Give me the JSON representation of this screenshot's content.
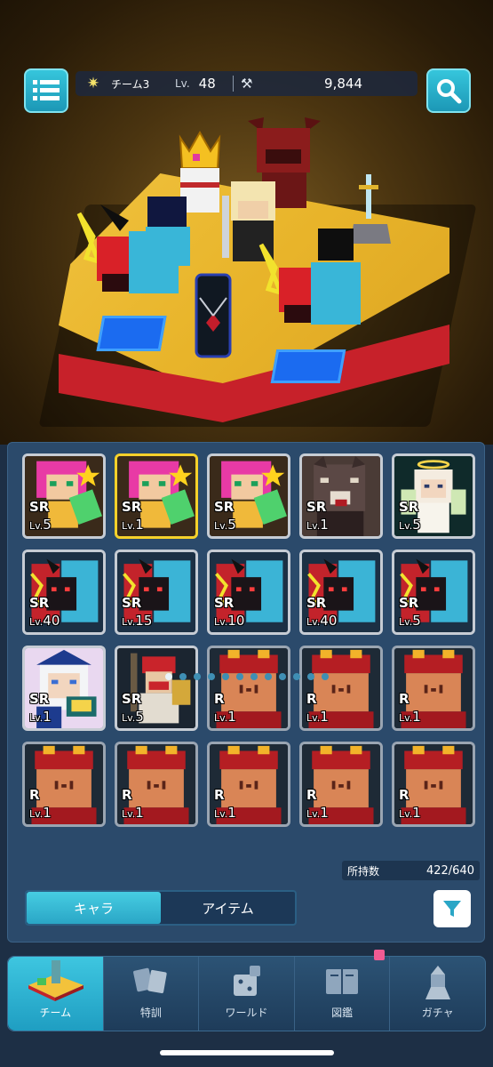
{
  "header": {
    "team_name": "チーム3",
    "level_label": "Lv.",
    "level_value": "48",
    "power_value": "9,844",
    "icons": [
      "list-menu-icon",
      "team-star-icon",
      "power-icon",
      "search-icon"
    ]
  },
  "inventory": {
    "cards": [
      {
        "rank": "SR",
        "level": "5",
        "art": "pink-hair-girl",
        "selected": false
      },
      {
        "rank": "SR",
        "level": "1",
        "art": "pink-hair-girl",
        "selected": true
      },
      {
        "rank": "SR",
        "level": "5",
        "art": "pink-hair-girl",
        "selected": false
      },
      {
        "rank": "SR",
        "level": "1",
        "art": "wolf",
        "selected": false
      },
      {
        "rank": "SR",
        "level": "5",
        "art": "angel",
        "selected": false
      },
      {
        "rank": "SR",
        "level": "40",
        "art": "red-blue-beast",
        "selected": false
      },
      {
        "rank": "SR",
        "level": "15",
        "art": "red-blue-beast",
        "selected": false
      },
      {
        "rank": "SR",
        "level": "10",
        "art": "red-blue-beast",
        "selected": false
      },
      {
        "rank": "SR",
        "level": "40",
        "art": "red-blue-beast",
        "selected": false
      },
      {
        "rank": "SR",
        "level": "5",
        "art": "red-blue-beast",
        "selected": false
      },
      {
        "rank": "SR",
        "level": "1",
        "art": "white-hair-mage",
        "selected": false
      },
      {
        "rank": "SR",
        "level": "5",
        "art": "red-warrior",
        "selected": false
      },
      {
        "rank": "R",
        "level": "1",
        "art": "red-helmet",
        "selected": false
      },
      {
        "rank": "R",
        "level": "1",
        "art": "red-helmet",
        "selected": false
      },
      {
        "rank": "R",
        "level": "1",
        "art": "red-helmet",
        "selected": false
      },
      {
        "rank": "R",
        "level": "1",
        "art": "red-helmet",
        "selected": false
      },
      {
        "rank": "R",
        "level": "1",
        "art": "red-helmet",
        "selected": false
      },
      {
        "rank": "R",
        "level": "1",
        "art": "red-helmet",
        "selected": false
      },
      {
        "rank": "R",
        "level": "1",
        "art": "red-helmet",
        "selected": false
      },
      {
        "rank": "R",
        "level": "1",
        "art": "red-helmet",
        "selected": false
      }
    ],
    "level_prefix": "Lv.",
    "page_count": 12,
    "page_index": 0,
    "owned_label": "所持数",
    "owned_value": "422/640",
    "tabs": [
      {
        "label": "キャラ",
        "active": true
      },
      {
        "label": "アイテム",
        "active": false
      }
    ]
  },
  "nav": {
    "items": [
      {
        "label": "チーム",
        "icon": "team-board-icon",
        "active": true
      },
      {
        "label": "特訓",
        "icon": "training-cards-icon",
        "active": false
      },
      {
        "label": "ワールド",
        "icon": "world-dice-icon",
        "active": false
      },
      {
        "label": "図鑑",
        "icon": "book-icon",
        "active": false
      },
      {
        "label": "ガチャ",
        "icon": "gacha-icon",
        "active": false
      }
    ]
  },
  "colors": {
    "accent": "#2aa6c6",
    "panel": "#2b4a6b",
    "selected_border": "#f6d12a",
    "badge": "#f15b93"
  }
}
